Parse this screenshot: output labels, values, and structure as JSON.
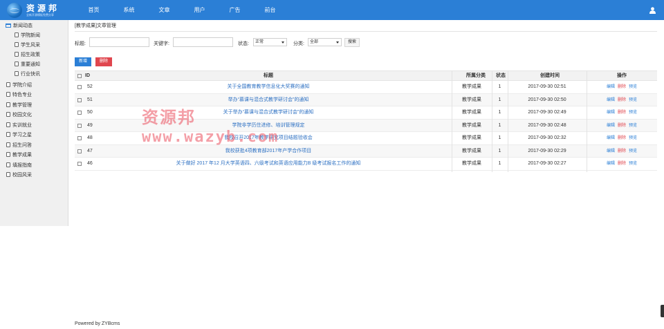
{
  "header": {
    "logo_title": "资源邦",
    "logo_subtitle": "全新开源模板免费分享",
    "nav": [
      "首页",
      "系统",
      "文章",
      "用户",
      "广告",
      "前台"
    ]
  },
  "sidebar": {
    "items": [
      {
        "label": "新闻动态",
        "level": 0
      },
      {
        "label": "学院新闻",
        "level": 1
      },
      {
        "label": "学生风采",
        "level": 1
      },
      {
        "label": "招生政策",
        "level": 1
      },
      {
        "label": "重要通知",
        "level": 1
      },
      {
        "label": "行业快讯",
        "level": 1
      },
      {
        "label": "学院介绍",
        "level": 0
      },
      {
        "label": "特色专业",
        "level": 0
      },
      {
        "label": "教学管理",
        "level": 0
      },
      {
        "label": "校园文化",
        "level": 0
      },
      {
        "label": "实训就业",
        "level": 0
      },
      {
        "label": "学习之星",
        "level": 0
      },
      {
        "label": "招生问答",
        "level": 0
      },
      {
        "label": "教学成果",
        "level": 0
      },
      {
        "label": "填报指南",
        "level": 0
      },
      {
        "label": "校园风采",
        "level": 0
      }
    ]
  },
  "page": {
    "breadcrumb": "[教学成果]文章管理"
  },
  "filters": {
    "title_label": "标题:",
    "title_value": "",
    "keyword_label": "关键字:",
    "keyword_value": "",
    "status_label": "状态:",
    "status_value": "正常",
    "category_label": "分类:",
    "category_value": "全部",
    "search_button": "搜索"
  },
  "toolbar": {
    "add_label": "新增",
    "delete_label": "删除"
  },
  "table": {
    "columns": [
      "ID",
      "标题",
      "所属分类",
      "状态",
      "创建时间",
      "操作"
    ],
    "actions": {
      "edit": "编辑",
      "delete": "删除",
      "preview": "预览"
    },
    "rows": [
      {
        "id": "52",
        "title": "关于全国教育教学信息化大奖赛的通知",
        "category": "教学成果",
        "status": "1",
        "created": "2017-09-30 02:51"
      },
      {
        "id": "51",
        "title": "举办“慕课与混合式教学研讨会”的通知",
        "category": "教学成果",
        "status": "1",
        "created": "2017-09-30 02:50"
      },
      {
        "id": "50",
        "title": "关于举办“慕课与混合式教学研讨会”的通知",
        "category": "教学成果",
        "status": "1",
        "created": "2017-09-30 02:49"
      },
      {
        "id": "49",
        "title": "学院非学历住进修、培训管理规定",
        "category": "教学成果",
        "status": "1",
        "created": "2017-09-30 02:48"
      },
      {
        "id": "48",
        "title": "我校召开2017年教学研究项目结题验收会",
        "category": "教学成果",
        "status": "1",
        "created": "2017-09-30 02:32"
      },
      {
        "id": "47",
        "title": "我校获批4项教育部2017年产学合作项目",
        "category": "教学成果",
        "status": "1",
        "created": "2017-09-30 02:29"
      },
      {
        "id": "46",
        "title": "关于做好 2017 年12 月大学英语四、六级考试和英语应用能力B 级考试报名工作的通知",
        "category": "教学成果",
        "status": "1",
        "created": "2017-09-30 02:27"
      }
    ]
  },
  "watermark": {
    "text_cn": "资源邦",
    "text_url": "www.wazyb.com"
  },
  "footer": {
    "text": "Powered by ZYBcms"
  },
  "colors": {
    "primary": "#2b7fd6",
    "danger": "#e0464e",
    "link": "#2b6fc2"
  }
}
